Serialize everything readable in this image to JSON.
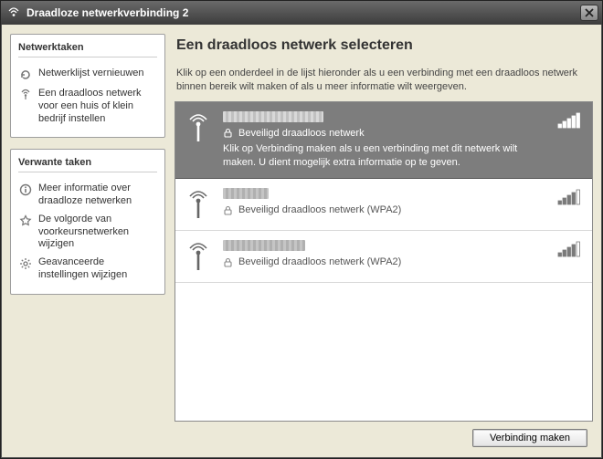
{
  "window": {
    "title": "Draadloze netwerkverbinding 2"
  },
  "sidebar": {
    "panel1_title": "Netwerktaken",
    "panel2_title": "Verwante taken",
    "tasks_net": [
      {
        "label": "Netwerklijst vernieuwen",
        "icon": "refresh"
      },
      {
        "label": "Een draadloos netwerk voor een huis of klein bedrijf instellen",
        "icon": "antenna"
      }
    ],
    "tasks_rel": [
      {
        "label": "Meer informatie over draadloze netwerken",
        "icon": "info"
      },
      {
        "label": "De volgorde van voorkeursnetwerken wijzigen",
        "icon": "star"
      },
      {
        "label": "Geavanceerde instellingen wijzigen",
        "icon": "gear"
      }
    ]
  },
  "main": {
    "heading": "Een draadloos netwerk selecteren",
    "subtitle": "Klik op een onderdeel in de lijst hieronder als u een verbinding met een draadloos netwerk binnen bereik wilt maken of als u meer informatie wilt weergeven.",
    "networks": [
      {
        "ssid_hidden_width": 110,
        "security": "Beveiligd draadloos netwerk",
        "desc": "Klik op Verbinding maken als u een verbinding met dit netwerk wilt maken. U dient mogelijk extra informatie op te geven.",
        "signal": 5,
        "locked": true,
        "selected": true
      },
      {
        "ssid_hidden_width": 50,
        "security": "Beveiligd draadloos netwerk (WPA2)",
        "desc": "",
        "signal": 4,
        "locked": true,
        "selected": false
      },
      {
        "ssid_hidden_width": 90,
        "security": "Beveiligd draadloos netwerk (WPA2)",
        "desc": "",
        "signal": 4,
        "locked": true,
        "selected": false
      }
    ]
  },
  "footer": {
    "connect_label": "Verbinding maken"
  }
}
